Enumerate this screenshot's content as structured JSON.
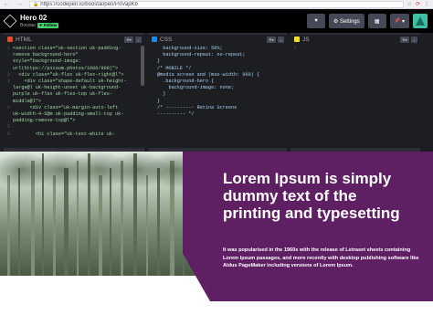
{
  "browser": {
    "url": "https://codepen.io/boostai/pen/PoVapKb",
    "nav_back": "←",
    "nav_forward": "→",
    "lock": "🔒",
    "icons": [
      "☆",
      "⟳",
      "⋮"
    ]
  },
  "codepen": {
    "title": "Hero 02",
    "user": "Boostai",
    "badge": "✦ Follow",
    "like_label": "♥",
    "settings_label": "⚙ Settings",
    "layout_label": "▦",
    "pin_label": "▾",
    "pin_icon": "📌"
  },
  "editors": {
    "html": {
      "label": "HTML",
      "lines": [
        {
          "n": "1",
          "text": "<section class=\"uk-section uk-padding-"
        },
        {
          "n": "",
          "text": "remove background-hero\""
        },
        {
          "n": "",
          "text": "style=\"background-image:"
        },
        {
          "n": "",
          "text": "url(https://picsum.photos/1600/900)\">"
        },
        {
          "n": "2",
          "text": "  <div class=\"uk-flex uk-flex-right@l\">"
        },
        {
          "n": "3",
          "text": "    <div class=\"shape-default uk-height-"
        },
        {
          "n": "",
          "text": "large@l uk-height-unset uk-background-"
        },
        {
          "n": "",
          "text": "purple uk-flex uk-flex-top uk-flex-"
        },
        {
          "n": "",
          "text": "middle@l\">"
        },
        {
          "n": "4",
          "text": "      <div class=\"uk-margin-auto-left"
        },
        {
          "n": "",
          "text": "uk-width-4-5@m uk-padding-small-top uk-"
        },
        {
          "n": "",
          "text": "padding-remove-top@l\">"
        },
        {
          "n": "5",
          "text": ""
        },
        {
          "n": "6",
          "text": "        <h1 class=\"uk-text-white uk-"
        }
      ]
    },
    "css": {
      "label": "CSS",
      "lines": [
        {
          "n": "",
          "text": "  background-size: 50%;"
        },
        {
          "n": "",
          "text": "  background-repeat: no-repeat;"
        },
        {
          "n": "",
          "text": ""
        },
        {
          "n": "",
          "text": "}"
        },
        {
          "n": "",
          "text": ""
        },
        {
          "n": "",
          "text": ""
        },
        {
          "n": "",
          "text": "/* MOBILE */"
        },
        {
          "n": "",
          "text": "@media screen and (max-width: 960) {"
        },
        {
          "n": "",
          "text": "  .background-hero {"
        },
        {
          "n": "",
          "text": "    background-image: none;"
        },
        {
          "n": "",
          "text": "  }"
        },
        {
          "n": "",
          "text": "}"
        },
        {
          "n": "",
          "text": ""
        },
        {
          "n": "",
          "text": "/* ---------- Retina Screens"
        },
        {
          "n": "",
          "text": "---------- */"
        }
      ]
    },
    "js": {
      "label": "JS",
      "lines": [
        {
          "n": "1",
          "text": ""
        }
      ]
    }
  },
  "hero": {
    "title": "Lorem Ipsum is simply dummy text of the printing and typesetting",
    "body": "It was popularised in the 1960s with the release of Letraset sheets containing Lorem Ipsum passages, and more recently with desktop publishing software like Aldus PageMaker including versions of Lorem Ipsum."
  },
  "colors": {
    "purple": "#5f1f63",
    "codepen_black": "#010101",
    "editor_bg": "#1d1e22",
    "follow_green": "#47cf73"
  }
}
